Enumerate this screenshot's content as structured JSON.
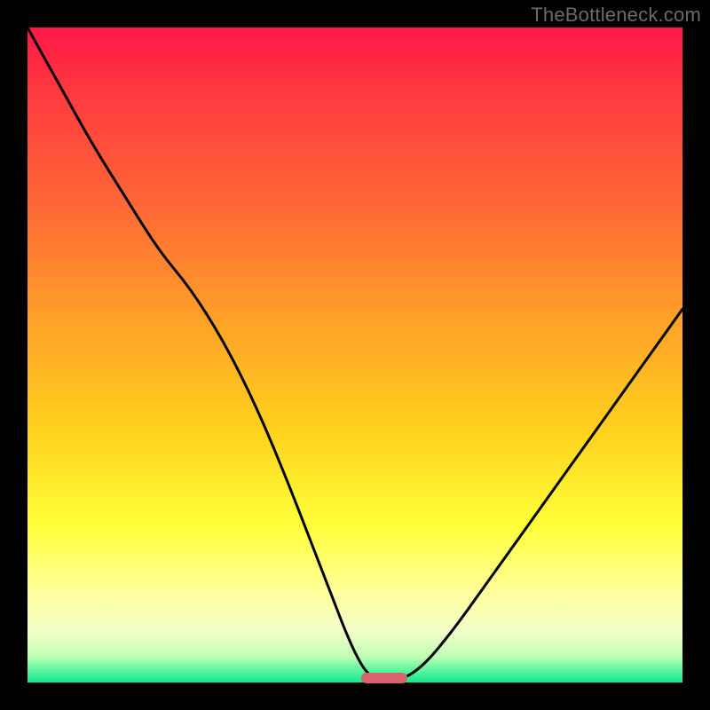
{
  "watermark": "TheBottleneck.com",
  "colors": {
    "curve": "#000000",
    "marker": "#d9636a"
  },
  "chart_data": {
    "type": "line",
    "title": "",
    "xlabel": "",
    "ylabel": "",
    "xlim": [
      0,
      1
    ],
    "ylim": [
      0,
      1
    ],
    "grid": false,
    "legend": false,
    "x": [
      0.0,
      0.05,
      0.1,
      0.15,
      0.2,
      0.25,
      0.3,
      0.35,
      0.4,
      0.45,
      0.5,
      0.53,
      0.56,
      0.6,
      0.65,
      0.7,
      0.75,
      0.8,
      0.85,
      0.9,
      0.95,
      1.0
    ],
    "values": [
      1.0,
      0.91,
      0.82,
      0.74,
      0.66,
      0.6,
      0.52,
      0.42,
      0.3,
      0.17,
      0.04,
      0.0,
      0.0,
      0.02,
      0.08,
      0.15,
      0.22,
      0.29,
      0.36,
      0.43,
      0.5,
      0.57
    ],
    "marker": {
      "x_center": 0.545,
      "width": 0.07,
      "y": 0.007
    },
    "notes": "y is fraction of plot height from bottom; curve touches 0 near x≈0.53–0.56 then rises again"
  }
}
